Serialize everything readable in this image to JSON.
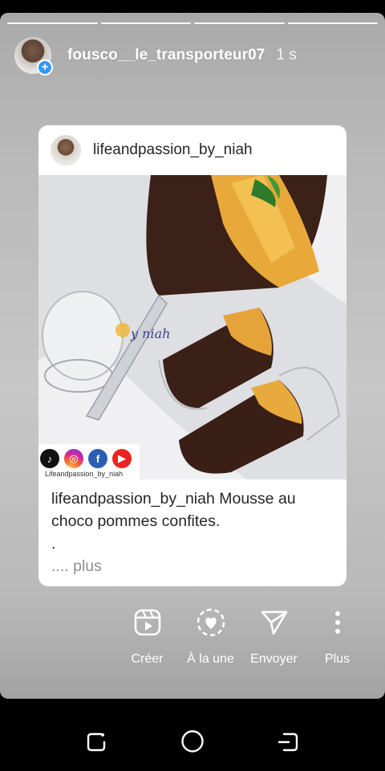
{
  "progress": {
    "segments": 4,
    "active_index": 3
  },
  "header": {
    "username": "fousco__le_transporteur07",
    "time": "1 s",
    "add_badge": "+"
  },
  "card": {
    "username": "lifeandpassion_by_niah",
    "image_watermark": "by niah",
    "social_handle": "Lifeandpassion_by_niah",
    "social_icons": [
      "tiktok-icon",
      "instagram-icon",
      "facebook-icon",
      "youtube-icon"
    ],
    "caption_user": "lifeandpassion_by_niah",
    "caption_text": "Mousse au choco pommes confites.",
    "caption_dot": ".",
    "caption_more_prefix": "....",
    "caption_more": "plus"
  },
  "actions": [
    {
      "icon": "reels-icon",
      "label": "Créer"
    },
    {
      "icon": "highlight-icon",
      "label": "À la une"
    },
    {
      "icon": "send-icon",
      "label": "Envoyer"
    },
    {
      "icon": "more-icon",
      "label": "Plus"
    }
  ],
  "colors": {
    "accent_blue": "#3797f0",
    "background_gray": "#bdbdbd",
    "text_dark": "#262626",
    "muted": "#8e8e8e"
  }
}
